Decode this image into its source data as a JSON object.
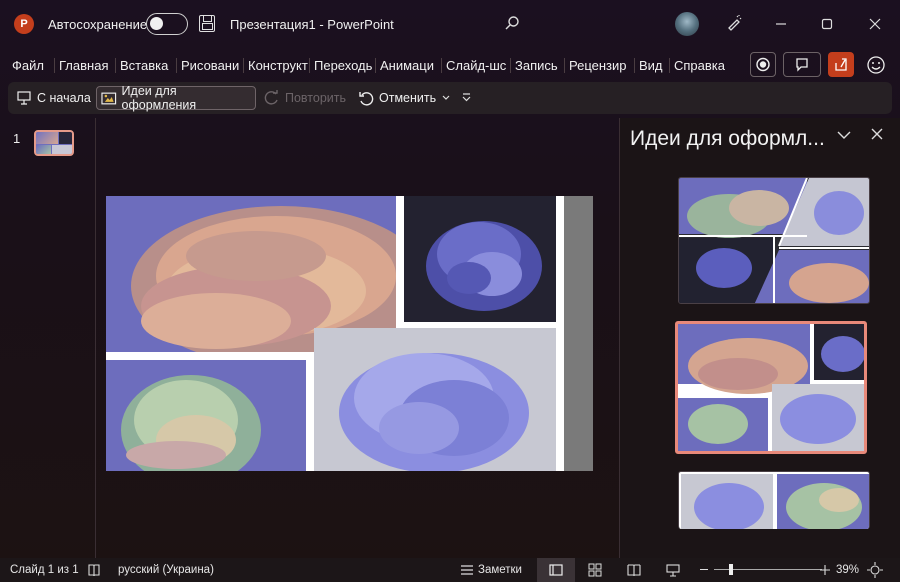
{
  "titlebar": {
    "app_logo": "P",
    "autosave_label": "Автосохранение",
    "document_title": "Презентация1  -  PowerPoint",
    "autosave_on": false
  },
  "ribbon": {
    "tabs": [
      "Файл",
      "Главная",
      "Вставка",
      "Рисовани",
      "Конструкт",
      "Переходь",
      "Анимаци",
      "Слайд-шс",
      "Запись",
      "Рецензир",
      "Вид",
      "Справка"
    ]
  },
  "quickbar": {
    "from_start": "С начала",
    "design_ideas": "Идеи для оформления",
    "redo": "Повторить",
    "undo": "Отменить"
  },
  "thumbnails": {
    "slide_number": "1"
  },
  "design_pane": {
    "title": "Идеи для оформл...",
    "selected_index": 1
  },
  "status": {
    "slide_info": "Слайд 1 из 1",
    "language": "русский (Украина)",
    "notes": "Заметки",
    "zoom": "39%"
  },
  "colors": {
    "accent": "#c43e1c",
    "selection": "#e8897a",
    "slide_bg_purple": "#6f6fbd",
    "gray_bar": "#7a7a7a"
  }
}
